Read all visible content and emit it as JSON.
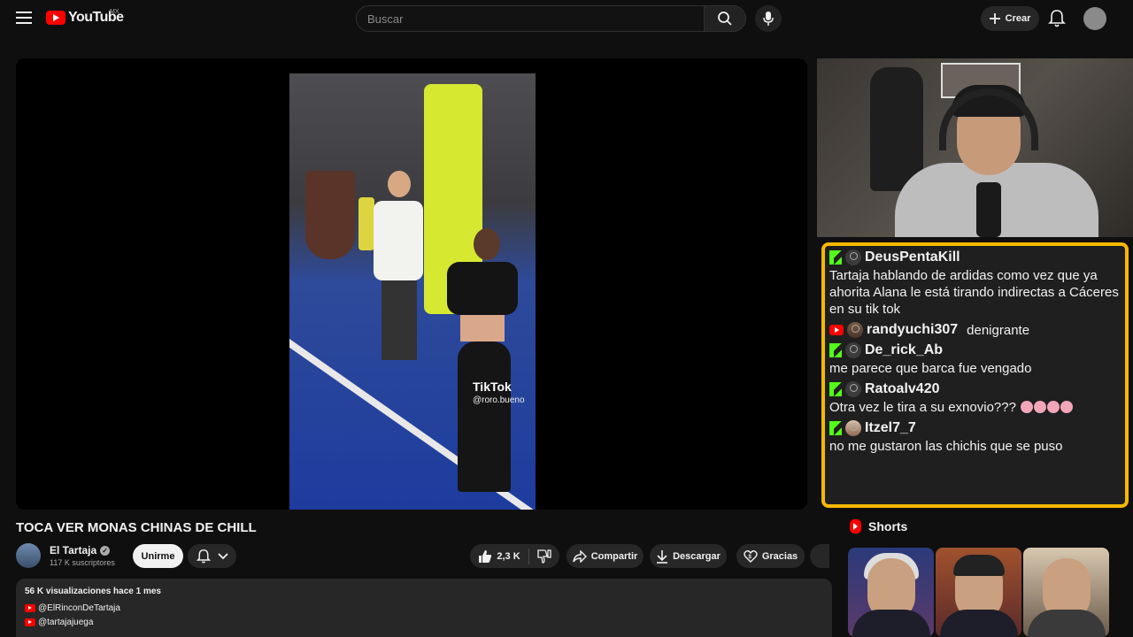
{
  "header": {
    "logo_text": "YouTube",
    "country": "MX",
    "search_placeholder": "Buscar",
    "create_label": "Crear"
  },
  "video": {
    "title": "TOCA VER MONAS CHINAS DE CHILL",
    "overlay_brand": "TikTok",
    "overlay_handle": "@roro.bueno"
  },
  "chat": [
    {
      "platform": "kick",
      "user": "DeusPentaKill",
      "text": "Tartaja hablando de ardidas como vez que ya ahorita Alana le está tirando indirectas a Cáceres en su tik tok"
    },
    {
      "platform": "youtube",
      "user": "randyuchi307",
      "text": "denigrante"
    },
    {
      "platform": "kick",
      "user": "De_rick_Ab",
      "text": "me parece que barca fue vengado"
    },
    {
      "platform": "kick",
      "user": "Ratoalv420",
      "text": "Otra vez le tira a su exnovio???"
    },
    {
      "platform": "kick",
      "user": "Itzel7_7",
      "text": "no me gustaron las chichis que se puso"
    }
  ],
  "channel": {
    "name": "El Tartaja",
    "subscribers": "117 K suscriptores",
    "join_label": "Unirme"
  },
  "actions": {
    "likes": "2,3 K",
    "share": "Compartir",
    "download": "Descargar",
    "thanks": "Gracias"
  },
  "description": {
    "meta": "56 K visualizaciones  hace 1 mes",
    "links": [
      "@ElRinconDeTartaja",
      "@tartajajuega"
    ]
  },
  "shorts": {
    "heading": "Shorts"
  },
  "colors": {
    "brand_red": "#ff0000",
    "chat_border": "#f5b800",
    "kick_green": "#53fc18",
    "background": "#0f0f0f"
  }
}
